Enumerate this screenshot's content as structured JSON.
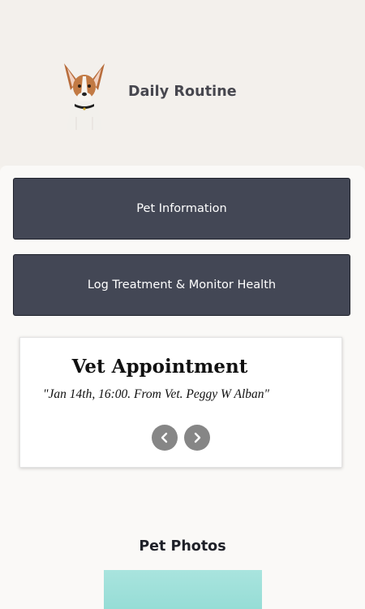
{
  "header": {
    "title": "Daily Routine",
    "avatar_icon": "dog-avatar-icon"
  },
  "nav_buttons": [
    {
      "label": "Pet Information"
    },
    {
      "label": "Log Treatment & Monitor Health"
    }
  ],
  "appointment_card": {
    "title": "Vet Appointment",
    "quote": "\"Jan 14th, 16:00. From Vet. Peggy W Alban\"",
    "prev_icon": "chevron-left-icon",
    "next_icon": "chevron-right-icon"
  },
  "photos": {
    "heading": "Pet Photos",
    "thumb_color": "#a3e2dc"
  },
  "colors": {
    "button_bg": "#434755",
    "page_bg": "#f4f1ed",
    "header_text": "#47474f"
  }
}
